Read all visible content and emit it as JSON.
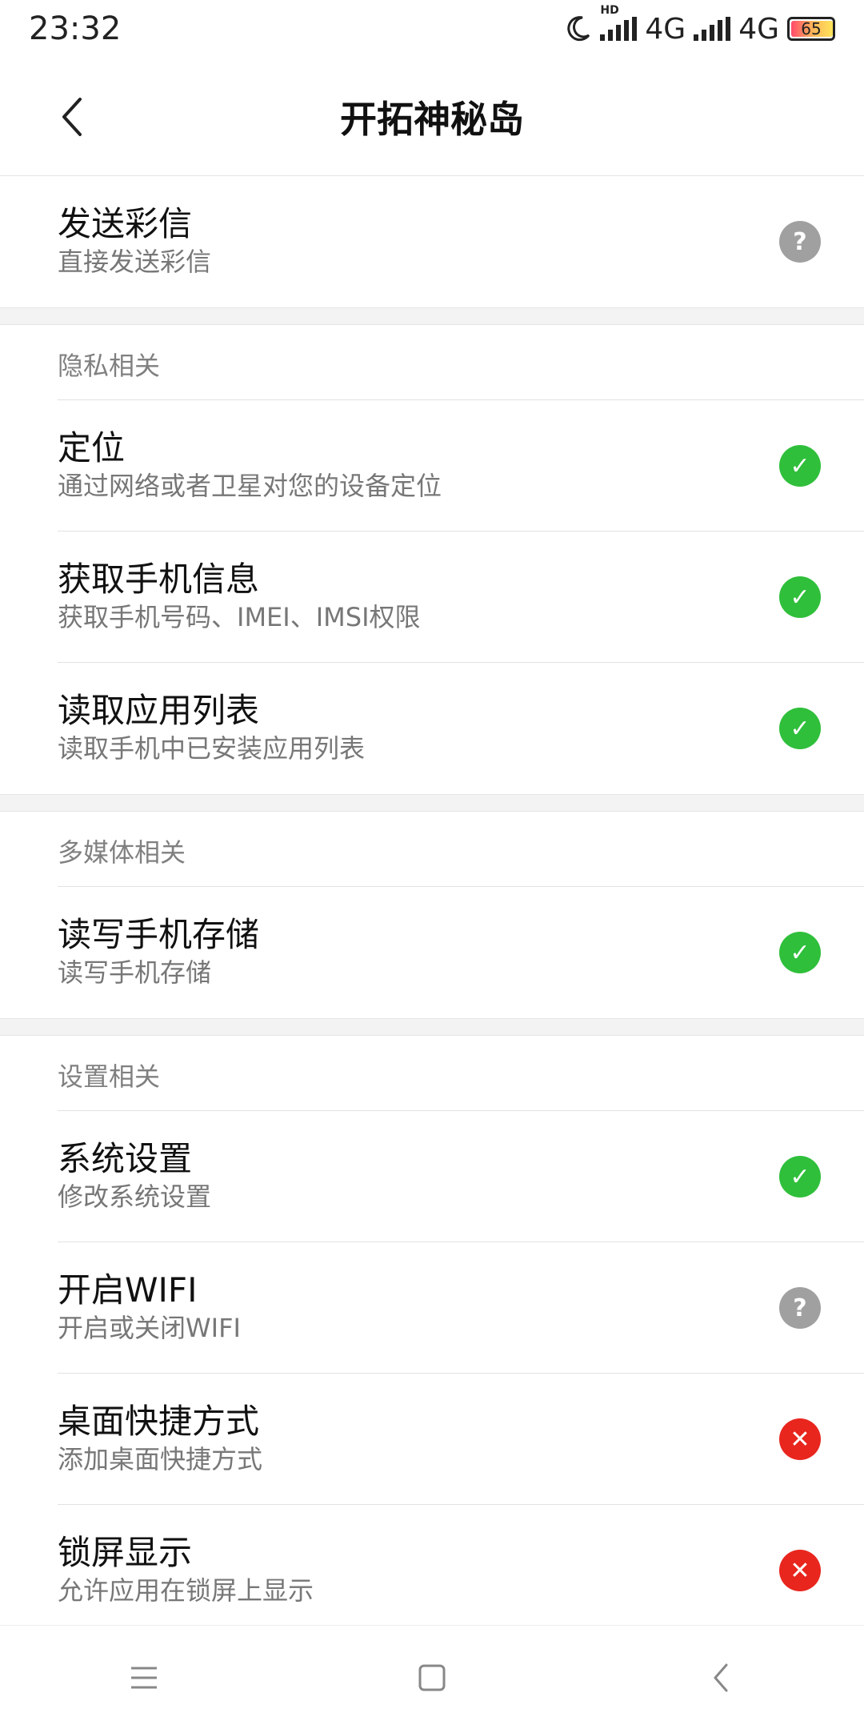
{
  "status_bar": {
    "time": "23:32",
    "network1": "4G",
    "network2": "4G",
    "hd": "HD",
    "battery": "65"
  },
  "header": {
    "title": "开拓神秘岛"
  },
  "first_item": {
    "label": "发送彩信",
    "sub": "直接发送彩信",
    "status": "unknown"
  },
  "sections": [
    {
      "title": "隐私相关",
      "items": [
        {
          "label": "定位",
          "sub": "通过网络或者卫星对您的设备定位",
          "status": "allowed"
        },
        {
          "label": "获取手机信息",
          "sub": "获取手机号码、IMEI、IMSI权限",
          "status": "allowed"
        },
        {
          "label": "读取应用列表",
          "sub": "读取手机中已安装应用列表",
          "status": "allowed"
        }
      ]
    },
    {
      "title": "多媒体相关",
      "items": [
        {
          "label": "读写手机存储",
          "sub": "读写手机存储",
          "status": "allowed"
        }
      ]
    },
    {
      "title": "设置相关",
      "items": [
        {
          "label": "系统设置",
          "sub": "修改系统设置",
          "status": "allowed"
        },
        {
          "label": "开启WIFI",
          "sub": "开启或关闭WIFI",
          "status": "unknown"
        },
        {
          "label": "桌面快捷方式",
          "sub": "添加桌面快捷方式",
          "status": "denied"
        },
        {
          "label": "锁屏显示",
          "sub": "允许应用在锁屏上显示",
          "status": "denied"
        }
      ]
    }
  ],
  "colors": {
    "allowed": "#2fbf3b",
    "unknown": "#a0a0a0",
    "denied": "#e8261e"
  },
  "icons": {
    "allowed": "check-icon",
    "unknown": "question-icon",
    "denied": "close-icon"
  }
}
